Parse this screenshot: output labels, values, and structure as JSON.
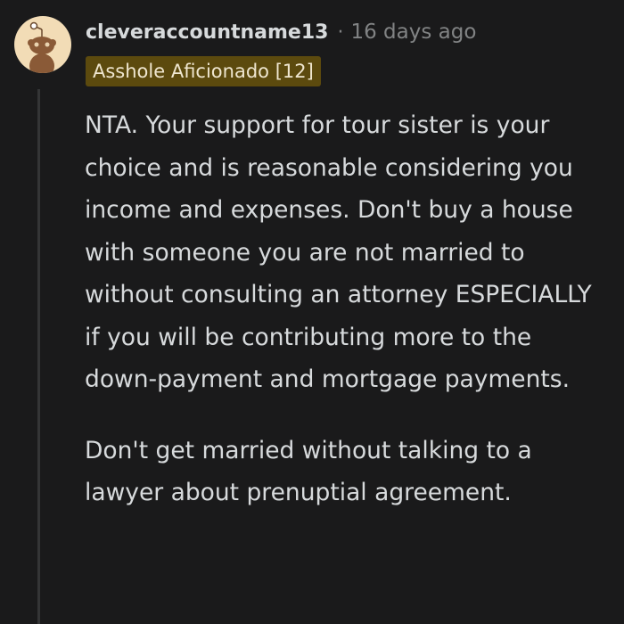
{
  "comment": {
    "author": "cleveraccountname13",
    "separator": "·",
    "timestamp": "16 days ago",
    "flair": "Asshole Aficionado [12]",
    "avatar_icon": "reddit-snoo-avatar-icon",
    "paragraphs": [
      "NTA. Your support for tour sister is your choice and is reasonable considering you income and expenses. Don't buy a house with someone you are not married to without consulting an attorney ESPECIALLY if you will be contributing more to the down-payment and mortgage payments.",
      "Don't get married without talking to a lawyer about prenuptial agreement."
    ]
  },
  "colors": {
    "background": "#1a1a1b",
    "text": "#d7dadc",
    "meta": "#818384",
    "flair_bg": "#5c4a0e",
    "avatar_bg": "#f2dcb6",
    "thread_line": "#343536"
  }
}
